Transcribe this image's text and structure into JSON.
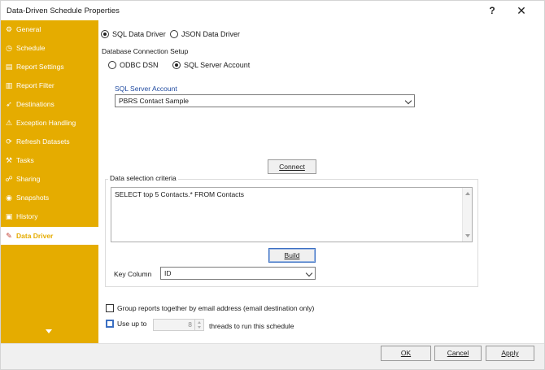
{
  "window": {
    "title": "Data-Driven Schedule Properties",
    "help": "?",
    "close": "✕"
  },
  "sidebar": {
    "items": [
      {
        "label": "General",
        "icon": "gear-icon",
        "glyph": "⚙"
      },
      {
        "label": "Schedule",
        "icon": "clock-icon",
        "glyph": "◷"
      },
      {
        "label": "Report Settings",
        "icon": "report-settings-icon",
        "glyph": "▤"
      },
      {
        "label": "Report Filter",
        "icon": "filter-icon",
        "glyph": "▥"
      },
      {
        "label": "Destinations",
        "icon": "destinations-icon",
        "glyph": "➶"
      },
      {
        "label": "Exception Handling",
        "icon": "warning-icon",
        "glyph": "⚠"
      },
      {
        "label": "Refresh Datasets",
        "icon": "refresh-icon",
        "glyph": "⟳"
      },
      {
        "label": "Tasks",
        "icon": "tasks-icon",
        "glyph": "⚒"
      },
      {
        "label": "Sharing",
        "icon": "sharing-icon",
        "glyph": "☍"
      },
      {
        "label": "Snapshots",
        "icon": "camera-icon",
        "glyph": "◉"
      },
      {
        "label": "History",
        "icon": "history-icon",
        "glyph": "▣"
      },
      {
        "label": "Data Driver",
        "icon": "data-driver-icon",
        "glyph": "✎",
        "active": true
      }
    ],
    "more_icon": "chevron-down-icon"
  },
  "source": {
    "sql_label": "SQL Data Driver",
    "json_label": "JSON Data Driver",
    "selected": "SQL Data Driver"
  },
  "connection": {
    "section_label": "Database Connection Setup",
    "odbc_label": "ODBC DSN",
    "sqlserver_label": "SQL Server Account",
    "selected": "SQL Server Account",
    "account_label": "SQL Server Account",
    "account_value": "PBRS Contact Sample",
    "connect_label": "Connect"
  },
  "criteria": {
    "group_label": "Data selection criteria",
    "query": "SELECT top 5 Contacts.* FROM Contacts",
    "build_label": "Build",
    "key_column_label": "Key Column",
    "key_column_value": "ID"
  },
  "options": {
    "group_reports_label": "Group reports together by email address (email destination only)",
    "group_reports_checked": false,
    "use_up_to_label": "Use up to",
    "use_up_to_checked": false,
    "threads_value": "8",
    "threads_suffix": "threads to run this schedule"
  },
  "footer": {
    "ok_label": "OK",
    "cancel_label": "Cancel",
    "apply_label": "Apply"
  },
  "colors": {
    "sidebar": "#e5ac00",
    "link": "#1f4aa0",
    "focus": "#3b6fc2"
  }
}
